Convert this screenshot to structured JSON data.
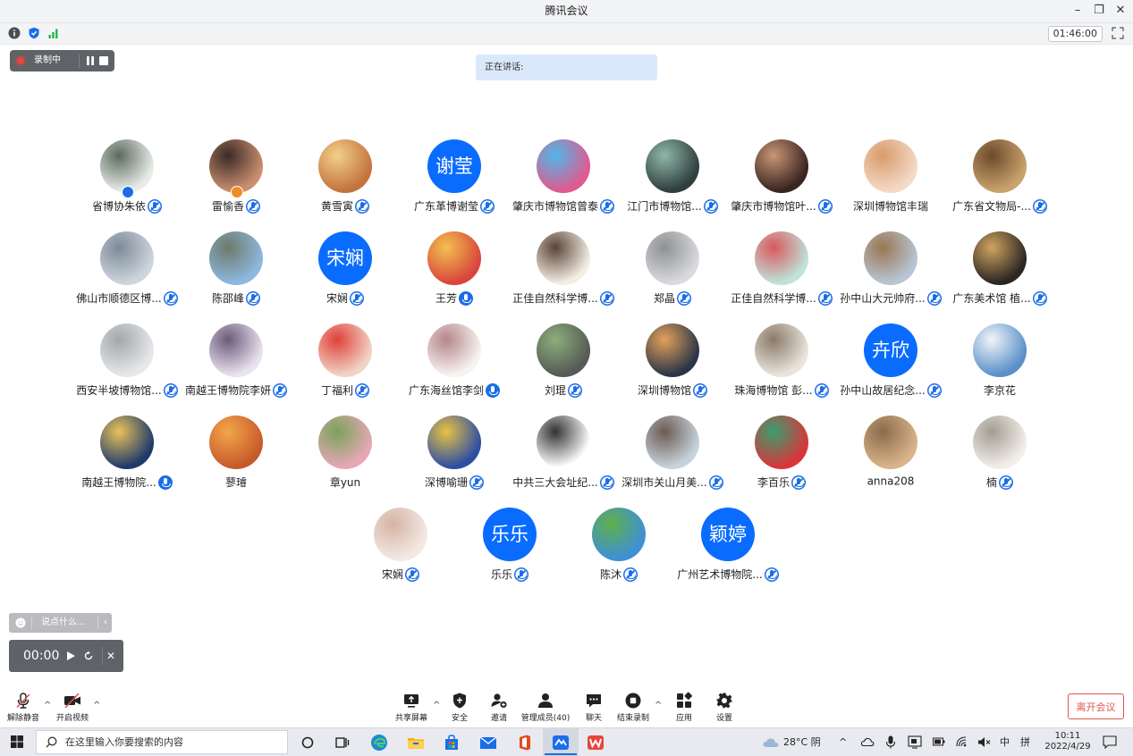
{
  "window": {
    "title": "腾讯会议"
  },
  "infobar": {
    "elapsed": "01:46:00"
  },
  "recording": {
    "label": "录制中"
  },
  "speaking": {
    "label": "正在讲话:"
  },
  "participants": [
    {
      "name": "省博协朱依",
      "avatar": "ink-painting",
      "mic": "muted"
    },
    {
      "name": "雷愉香",
      "avatar": "portrait-woman",
      "mic": "muted"
    },
    {
      "name": "黄雪寅",
      "avatar": "food-plate",
      "mic": "muted"
    },
    {
      "name": "广东革博谢莹",
      "avatar_text": "谢莹",
      "mic": "muted"
    },
    {
      "name": "肇庆市博物馆曾泰",
      "avatar": "colorful-hair",
      "mic": "muted"
    },
    {
      "name": "江门市博物馆...",
      "avatar": "anime-character",
      "mic": "muted"
    },
    {
      "name": "肇庆市博物馆叶...",
      "avatar": "portrait-glasses",
      "mic": "muted"
    },
    {
      "name": "深圳博物馆丰瑞",
      "avatar": "illustrated-girl-hat",
      "mic": "none"
    },
    {
      "name": "广东省文物局-...",
      "avatar": "interior-golden",
      "mic": "muted"
    },
    {
      "name": "佛山市顺德区博...",
      "avatar": "baby-photo",
      "mic": "muted"
    },
    {
      "name": "陈邵峰",
      "avatar": "mountain-landscape",
      "mic": "muted"
    },
    {
      "name": "宋娴",
      "avatar_text": "宋娴",
      "mic": "muted"
    },
    {
      "name": "王芳",
      "avatar": "abstract-painting",
      "mic": "on"
    },
    {
      "name": "正佳自然科学博...",
      "avatar": "cartoon-girl",
      "mic": "muted"
    },
    {
      "name": "郑晶",
      "avatar": "portrait-woman-grey",
      "mic": "muted"
    },
    {
      "name": "正佳自然科学博...",
      "avatar": "illustrated-flowers",
      "mic": "muted"
    },
    {
      "name": "孙中山大元帅府...",
      "avatar": "autumn-mountains",
      "mic": "muted"
    },
    {
      "name": "广东美术馆 植...",
      "avatar": "night-street",
      "mic": "muted"
    },
    {
      "name": "西安半坡博物馆...",
      "avatar": "snow-trees",
      "mic": "muted"
    },
    {
      "name": "南越王博物院李妍",
      "avatar": "anime-sketch",
      "mic": "muted"
    },
    {
      "name": "丁福利",
      "avatar": "baby-red-nose",
      "mic": "muted"
    },
    {
      "name": "广东海丝馆李剑",
      "avatar": "mother-child-sketch",
      "mic": "on"
    },
    {
      "name": "刘琨",
      "avatar": "green-plant",
      "mic": "muted"
    },
    {
      "name": "深圳博物馆",
      "avatar": "sunset-couple",
      "mic": "muted"
    },
    {
      "name": "珠海博物馆 彭...",
      "avatar": "sleeping-dog",
      "mic": "muted"
    },
    {
      "name": "孙中山故居纪念...",
      "avatar_text": "卉欣",
      "mic": "muted"
    },
    {
      "name": "李京花",
      "avatar": "blue-sky-mountain",
      "mic": "none"
    },
    {
      "name": "南越王博物院...",
      "avatar": "pearl-earring-painting",
      "mic": "on"
    },
    {
      "name": "蓼璿",
      "avatar": "hallway-figure",
      "mic": "none"
    },
    {
      "name": "章yun",
      "avatar": "roses-bouquet",
      "mic": "none"
    },
    {
      "name": "深博喻珊",
      "avatar": "colorful-mosaic",
      "mic": "muted"
    },
    {
      "name": "中共三大会址纪...",
      "avatar": "ink-figure",
      "mic": "muted"
    },
    {
      "name": "深圳市关山月美...",
      "avatar": "woman-seaside",
      "mic": "muted"
    },
    {
      "name": "李百乐",
      "avatar": "cartoon-red",
      "mic": "muted"
    },
    {
      "name": "anna208",
      "avatar": "cat-face",
      "mic": "none"
    },
    {
      "name": "楠",
      "avatar": "sketch-girl",
      "mic": "muted"
    },
    {
      "name": "宋娴",
      "avatar": "hands-gesture",
      "mic": "muted"
    },
    {
      "name": "乐乐",
      "avatar_text": "乐乐",
      "mic": "muted"
    },
    {
      "name": "陈沐",
      "avatar": "dandelion-sky",
      "mic": "muted"
    },
    {
      "name": "广州艺术博物院...",
      "avatar_text": "颖婷",
      "mic": "muted"
    }
  ],
  "chat_input": {
    "placeholder": "说点什么..."
  },
  "timer": {
    "value": "00:00"
  },
  "toolbar": {
    "unmute": "解除静音",
    "start_video": "开启视频",
    "share_screen": "共享屏幕",
    "security": "安全",
    "invite": "邀请",
    "manage_members": "管理成员(40)",
    "chat": "聊天",
    "end_recording": "结束录制",
    "apps": "应用",
    "settings": "设置",
    "leave": "离开会议"
  },
  "taskbar": {
    "search_placeholder": "在这里输入你要搜索的内容",
    "weather": "28°C 阴",
    "ime_lang": "中",
    "ime_mode": "拼",
    "time": "10:11",
    "date": "2022/4/29"
  },
  "colors": {
    "accent": "#1a6dea",
    "avatar_blue": "#0a6cff",
    "leave_red": "#e0554f",
    "record_red": "#e8453c"
  }
}
